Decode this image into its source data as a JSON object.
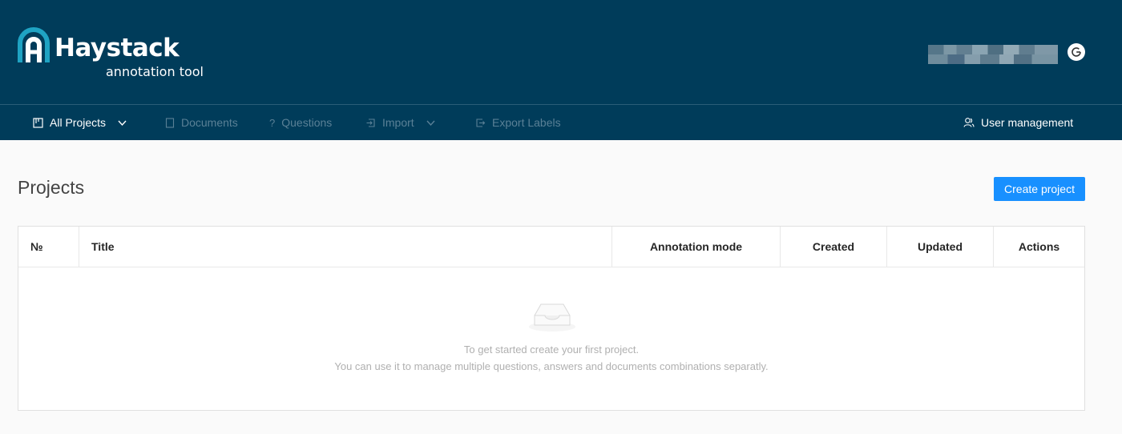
{
  "header": {
    "logo_word": "Haystack",
    "logo_sub": "annotation tool",
    "brand_color": "#003c5a",
    "accent_color": "#1fa3c3"
  },
  "nav": {
    "all_projects": "All Projects",
    "documents": "Documents",
    "questions": "Questions",
    "import": "Import",
    "export_labels": "Export Labels",
    "user_management": "User management"
  },
  "main": {
    "title": "Projects",
    "create_button": "Create project",
    "button_color": "#1890ff"
  },
  "table": {
    "columns": [
      "№",
      "Title",
      "Annotation mode",
      "Created",
      "Updated",
      "Actions"
    ],
    "empty_line1": "To get started create your first project.",
    "empty_line2": "You can use it to manage multiple questions, answers and documents combinations separatly."
  },
  "icons": {
    "logo": "haystack-logo-icon",
    "google": "google-icon",
    "projects": "board-icon",
    "documents": "document-icon",
    "questions": "question-icon",
    "import": "import-icon",
    "export": "export-icon",
    "users": "users-icon",
    "empty": "inbox-icon"
  }
}
